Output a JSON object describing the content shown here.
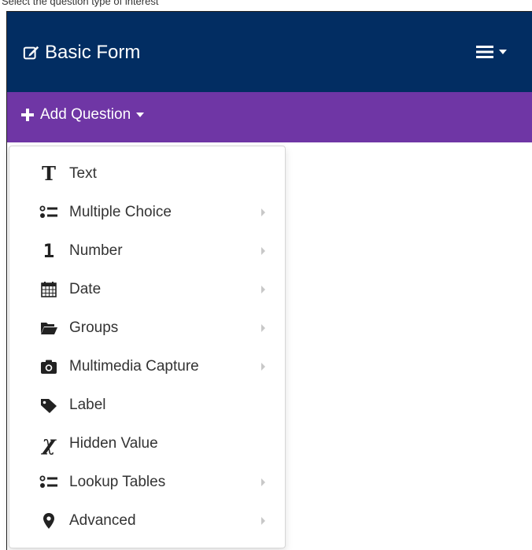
{
  "caption": "Select the question type of interest",
  "navbar": {
    "brand": "Basic Form",
    "brand_icon": "edit-icon",
    "menu_icon": "hamburger-icon",
    "background": "#022d62"
  },
  "toolbar": {
    "add_question_label": "Add Question",
    "background": "#6f36a5"
  },
  "menu": {
    "items": [
      {
        "label": "Text",
        "icon": "text-icon",
        "has_submenu": false
      },
      {
        "label": "Multiple Choice",
        "icon": "list-icon",
        "has_submenu": true
      },
      {
        "label": "Number",
        "icon": "number-icon",
        "has_submenu": true
      },
      {
        "label": "Date",
        "icon": "calendar-icon",
        "has_submenu": true
      },
      {
        "label": "Groups",
        "icon": "folder-icon",
        "has_submenu": true
      },
      {
        "label": "Multimedia Capture",
        "icon": "camera-icon",
        "has_submenu": true
      },
      {
        "label": "Label",
        "icon": "tag-icon",
        "has_submenu": false
      },
      {
        "label": "Hidden Value",
        "icon": "variable-icon",
        "has_submenu": false
      },
      {
        "label": "Lookup Tables",
        "icon": "list-icon",
        "has_submenu": true
      },
      {
        "label": "Advanced",
        "icon": "map-marker-icon",
        "has_submenu": true
      }
    ]
  }
}
